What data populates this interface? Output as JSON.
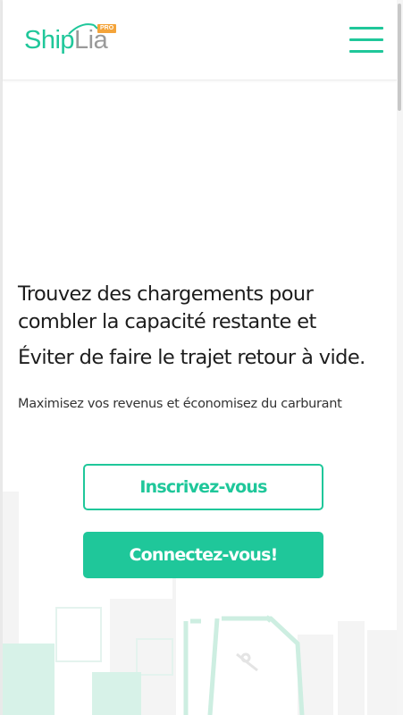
{
  "header": {
    "logo": {
      "ship": "Ship",
      "lia": "Lia",
      "badge": "PRO"
    },
    "menu_icon": "hamburger-menu-icon"
  },
  "hero": {
    "headline_line1": "Trouvez des chargements pour",
    "headline_line2": "combler la capacité restante et",
    "headline_line3": "Éviter de faire le trajet retour à vide.",
    "subtitle": "Maximisez vos revenus et économisez du carburant",
    "signup_button": "Inscrivez-vous",
    "login_button": "Connectez-vous!",
    "background_illustration": "warehouse-forklift-illustration"
  },
  "colors": {
    "brand_green": "#1fc79a",
    "logo_gray": "#9a9a9a",
    "badge_orange": "#f4a43a"
  }
}
